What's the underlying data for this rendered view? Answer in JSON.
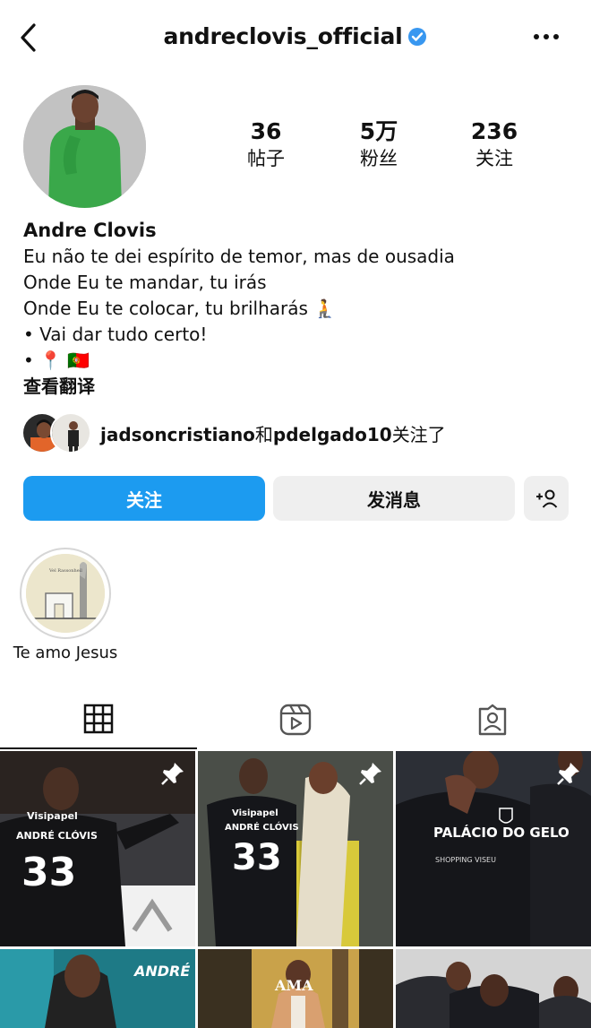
{
  "header": {
    "username": "andreclovis_official",
    "back_icon": "chevron-left-icon",
    "more_icon": "more-dots-icon",
    "verified_color": "#3897f0"
  },
  "stats": {
    "posts": {
      "value": "36",
      "label": "帖子"
    },
    "followers": {
      "value": "5万",
      "label": "粉丝"
    },
    "following": {
      "value": "236",
      "label": "关注"
    }
  },
  "bio": {
    "name": "Andre Clovis",
    "lines": [
      "Eu não te dei espírito de temor, mas de ousadia",
      "Onde Eu te mandar, tu irás",
      "Onde Eu te colocar, tu brilharás 🧎",
      "• Vai dar tudo certo!",
      "• 📍 🇵🇹"
    ],
    "translate_label": "查看翻译"
  },
  "followed_by": {
    "user1": "jadsoncristiano",
    "connector": "和",
    "user2": "pdelgado10",
    "suffix": "关注了"
  },
  "actions": {
    "follow_label": "关注",
    "message_label": "发消息",
    "add_user_icon": "add-user-icon",
    "follow_color": "#1c9bf0"
  },
  "highlights": [
    {
      "label": "Te amo Jesus"
    }
  ],
  "tabs": [
    {
      "icon": "grid-icon",
      "active": true
    },
    {
      "icon": "reels-icon",
      "active": false
    },
    {
      "icon": "tagged-icon",
      "active": false
    }
  ],
  "posts": [
    {
      "jersey_name": "ANDRÉ CLÓVIS",
      "number": "33",
      "sponsor": "Visipapel",
      "pinned": true
    },
    {
      "jersey_name": "ANDRÉ CLÓVIS",
      "number": "33",
      "sponsor": "Visipapel",
      "pinned": true
    },
    {
      "sponsor": "PALÁCIO DO GELO",
      "sponsor_sub": "SHOPPING VISEU",
      "pinned": true
    },
    {
      "overlay_text": "ANDRÉ CLÓVIS",
      "pinned": false
    },
    {
      "overlay_text": "AMA",
      "pinned": false
    },
    {
      "pinned": false
    }
  ]
}
